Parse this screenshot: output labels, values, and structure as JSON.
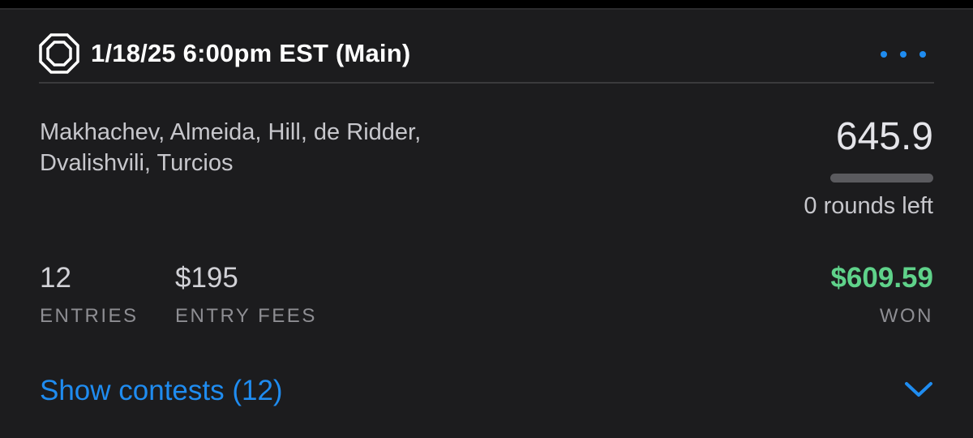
{
  "header": {
    "title": "1/18/25 6:00pm EST (Main)",
    "icon": "octagon-icon",
    "more_icon": "more-dots-icon"
  },
  "lineup": {
    "fighters_line1": "Makhachev, Almeida, Hill, de Ridder,",
    "fighters_line2": "Dvalishvili, Turcios",
    "score": "645.9",
    "progress_fraction": 1.0,
    "rounds_left": "0 rounds left"
  },
  "stats": {
    "entries_value": "12",
    "entries_label": "ENTRIES",
    "fees_value": "$195",
    "fees_label": "ENTRY FEES",
    "won_value": "$609.59",
    "won_label": "WON"
  },
  "footer": {
    "show_contests_label": "Show contests (12)",
    "chevron_icon": "chevron-down-icon"
  },
  "colors": {
    "accent": "#1f8cf0",
    "won": "#5fd28a",
    "card_background": "#1c1c1e"
  }
}
